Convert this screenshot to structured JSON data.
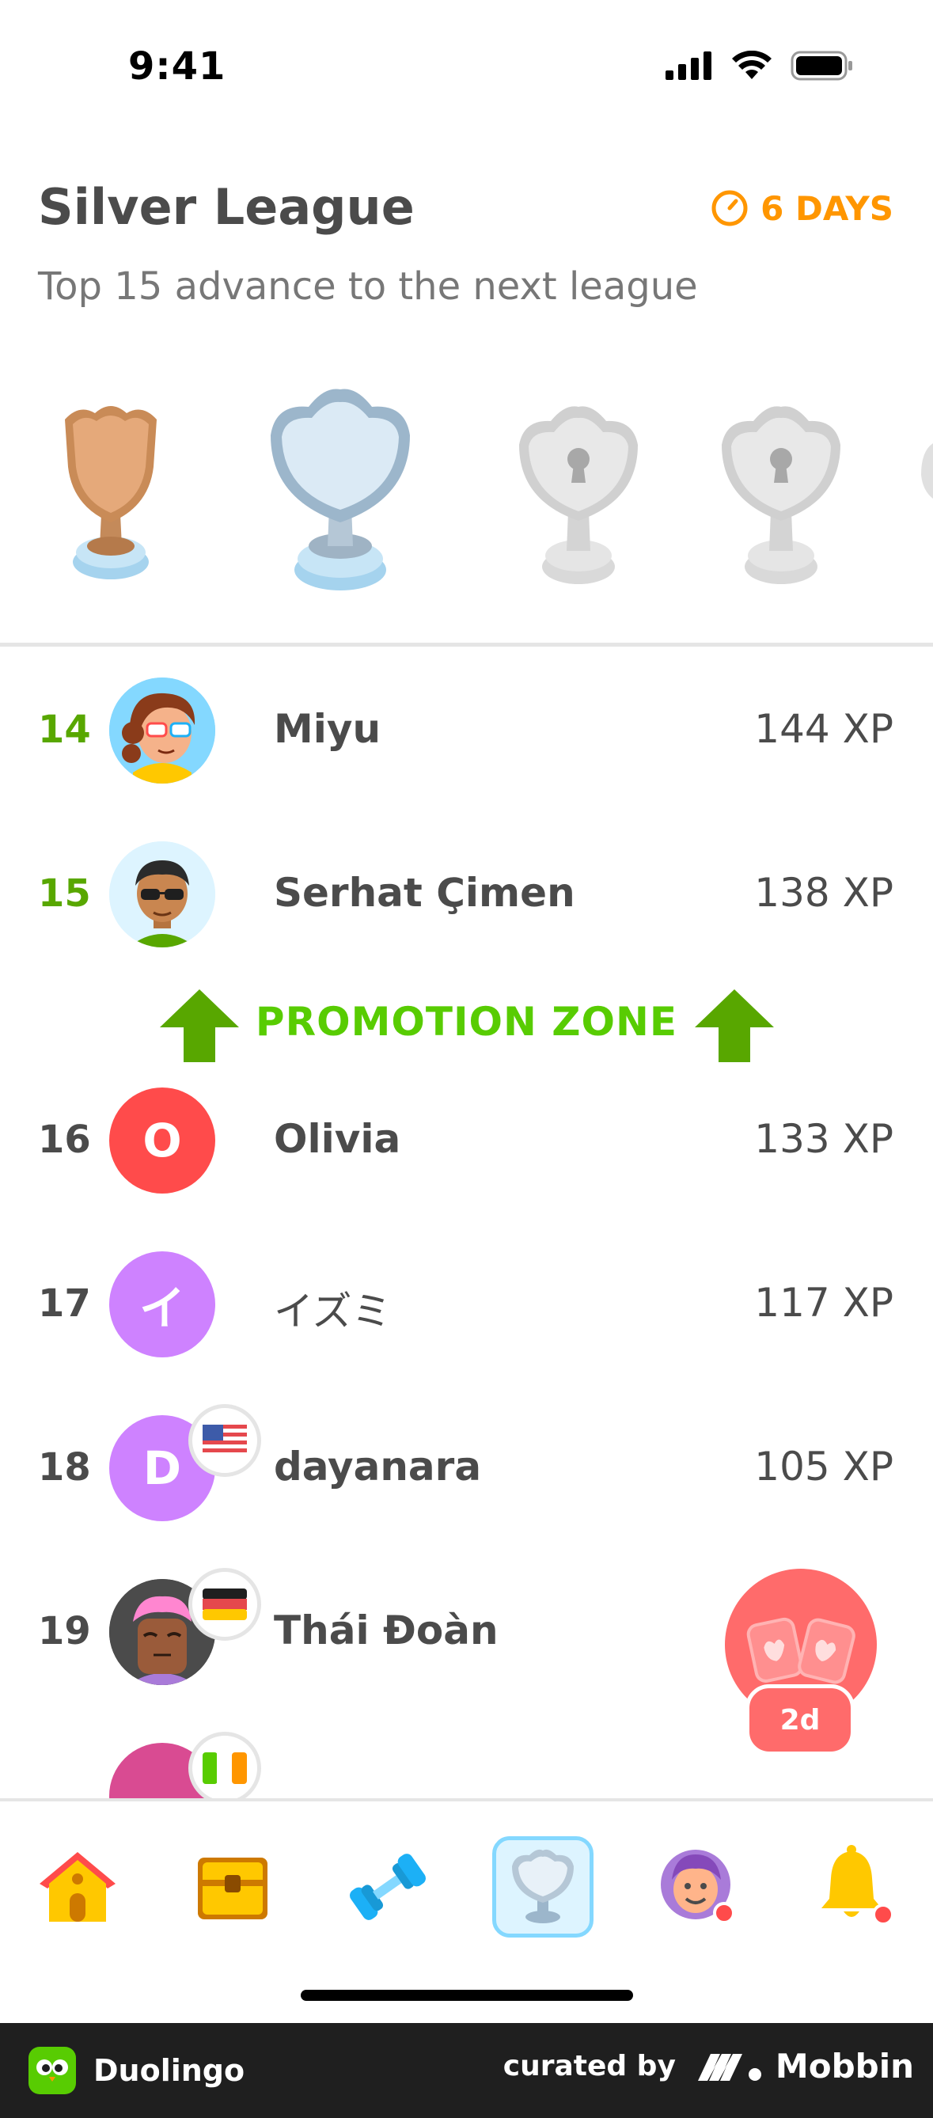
{
  "status_bar": {
    "time": "9:41"
  },
  "header": {
    "title": "Silver League",
    "timer": "6 DAYS",
    "subtitle": "Top 15 advance to the next league"
  },
  "colors": {
    "green": "#58cc02",
    "orange": "#ff9600",
    "red": "#ff4b4b",
    "purple": "#ce82ff",
    "active_tab_bg": "#ddf4ff"
  },
  "leaderboard": {
    "rows": [
      {
        "rank": "14",
        "name": "Miyu",
        "xp": "144 XP",
        "avatar": "illustrated-avatar-glasses",
        "flag": ""
      },
      {
        "rank": "15",
        "name": "Serhat Çimen",
        "xp": "138 XP",
        "avatar": "illustrated-avatar-sunglasses",
        "flag": ""
      },
      {
        "rank": "16",
        "name": "Olivia",
        "xp": "133 XP",
        "initial": "O",
        "flag": ""
      },
      {
        "rank": "17",
        "name": "イズミ",
        "xp": "117 XP",
        "initial": "イ",
        "flag": ""
      },
      {
        "rank": "18",
        "name": "dayanara",
        "xp": "105 XP",
        "initial": "D",
        "flag": "us-flag"
      },
      {
        "rank": "19",
        "name": "Thái Đoàn",
        "xp": "",
        "avatar": "illustrated-avatar-pink-hair",
        "flag": "de-flag"
      }
    ],
    "promotion_label": "PROMOTION ZONE"
  },
  "float_button": {
    "badge": "2d",
    "icon": "chest-icon"
  },
  "tabs": [
    {
      "name": "home",
      "icon": "house-icon",
      "active": false
    },
    {
      "name": "chest",
      "icon": "treasure-chest-icon",
      "active": false
    },
    {
      "name": "practice",
      "icon": "dumbbell-icon",
      "active": false
    },
    {
      "name": "leagues",
      "icon": "trophy-icon",
      "active": true
    },
    {
      "name": "profile",
      "icon": "profile-avatar-icon",
      "active": false
    },
    {
      "name": "notifications",
      "icon": "bell-icon",
      "active": false
    }
  ],
  "footer": {
    "app_name": "Duolingo",
    "curated_by": "curated by",
    "brand": "Mobbin"
  }
}
